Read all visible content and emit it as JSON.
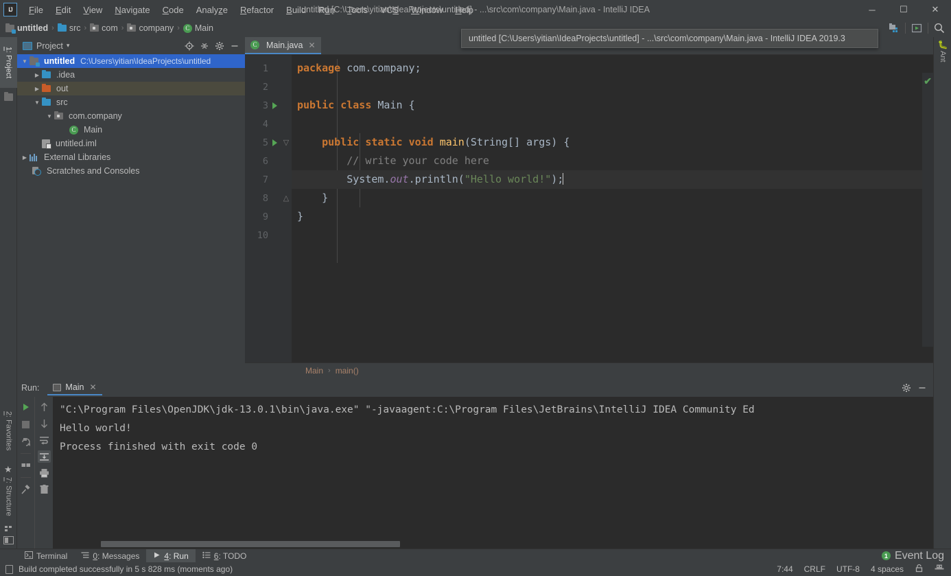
{
  "window": {
    "title": "untitled [C:\\Users\\yitian\\IdeaProjects\\untitled] - ...\\src\\com\\company\\Main.java - IntelliJ IDEA",
    "logo_text": "IJ",
    "minimize": "─",
    "maximize": "☐",
    "close": "✕"
  },
  "tooltip": {
    "text": "untitled [C:\\Users\\yitian\\IdeaProjects\\untitled] - ...\\src\\com\\company\\Main.java - IntelliJ IDEA 2019.3"
  },
  "menu": [
    {
      "label": "File",
      "mnemonic": "F"
    },
    {
      "label": "Edit",
      "mnemonic": "E"
    },
    {
      "label": "View",
      "mnemonic": "V"
    },
    {
      "label": "Navigate",
      "mnemonic": "N"
    },
    {
      "label": "Code",
      "mnemonic": "C"
    },
    {
      "label": "Analyze",
      "mnemonic": "z"
    },
    {
      "label": "Refactor",
      "mnemonic": "R"
    },
    {
      "label": "Build",
      "mnemonic": "B"
    },
    {
      "label": "Run",
      "mnemonic": "u"
    },
    {
      "label": "Tools",
      "mnemonic": "T"
    },
    {
      "label": "VCS",
      "mnemonic": "S"
    },
    {
      "label": "Window",
      "mnemonic": "W"
    },
    {
      "label": "Help",
      "mnemonic": "H"
    }
  ],
  "navbar": {
    "crumbs": [
      {
        "label": "untitled",
        "icon": "project-icon"
      },
      {
        "label": "src",
        "icon": "folder-blue-icon"
      },
      {
        "label": "com",
        "icon": "folder-package-icon"
      },
      {
        "label": "company",
        "icon": "folder-package-icon"
      },
      {
        "label": "Main",
        "icon": "java-class-icon"
      }
    ],
    "separator": "›"
  },
  "toolbar_right": {
    "icons": [
      "project-structure-icon",
      "run-console-icon",
      "search-everywhere-icon"
    ]
  },
  "left_rail": {
    "project": {
      "prefix": "1",
      "label": ": Project"
    },
    "favorites": {
      "prefix": "2",
      "label": ": Favorites"
    },
    "structure": {
      "prefix": "7",
      "label": ": Structure"
    }
  },
  "right_rail": {
    "ant": "Ant"
  },
  "project_panel": {
    "title": "Project",
    "chevron": "▾",
    "header_icons": [
      "locate-target-icon",
      "collapse-all-icon",
      "settings-gear-icon",
      "minimize-icon"
    ],
    "tree": [
      {
        "label": "untitled",
        "path": "C:\\Users\\yitian\\IdeaProjects\\untitled",
        "indent": 0,
        "arrow": "▼",
        "icon": "project-icon",
        "state": "selected",
        "bold": true
      },
      {
        "label": ".idea",
        "path": "",
        "indent": 1,
        "arrow": "▶",
        "icon": "folder-blue-icon",
        "state": "normal",
        "bold": false
      },
      {
        "label": "out",
        "path": "",
        "indent": 1,
        "arrow": "▶",
        "icon": "folder-orange-icon",
        "state": "hovered",
        "bold": false
      },
      {
        "label": "src",
        "path": "",
        "indent": 1,
        "arrow": "▼",
        "icon": "folder-blue-icon",
        "state": "normal",
        "bold": false
      },
      {
        "label": "com.company",
        "path": "",
        "indent": 2,
        "arrow": "▼",
        "icon": "folder-package-icon",
        "state": "normal",
        "bold": false
      },
      {
        "label": "Main",
        "path": "",
        "indent": 3,
        "arrow": "",
        "icon": "java-class-icon",
        "state": "normal",
        "bold": false
      },
      {
        "label": "untitled.iml",
        "path": "",
        "indent": 1,
        "arrow": "",
        "icon": "iml-file-icon",
        "state": "normal",
        "bold": false
      },
      {
        "label": "External Libraries",
        "path": "",
        "indent": 0,
        "arrow": "▶",
        "icon": "library-icon",
        "state": "normal",
        "bold": false
      },
      {
        "label": "Scratches and Consoles",
        "path": "",
        "indent": 0,
        "arrow": "",
        "icon": "scratches-icon",
        "state": "normal",
        "bold": false
      }
    ]
  },
  "editor": {
    "tab": {
      "label": "Main.java",
      "close": "✕",
      "icon": "java-class-icon"
    },
    "line_numbers": [
      "1",
      "2",
      "3",
      "4",
      "5",
      "6",
      "7",
      "8",
      "9",
      "10"
    ],
    "current_line": 7,
    "run_markers": [
      3,
      5
    ],
    "fold_markers": [
      5,
      8
    ],
    "inspection_status": "no-errors",
    "inspection_glyph": "✔",
    "code": {
      "l1_kw": "package",
      "l1_pkg": " com.company;",
      "l3_public": "public",
      "l3_class": "class",
      "l3_name": " Main ",
      "l3_brace": "{",
      "l5_public": "public",
      "l5_static": "static",
      "l5_void": "void",
      "l5_main": "main",
      "l5_args": "(String[] args) {",
      "l6_comment": "// write your code here",
      "l7_system": "System.",
      "l7_out": "out",
      "l7_println": ".println(",
      "l7_string": "\"Hello world!\"",
      "l7_tail": ");",
      "l8_brace": "}",
      "l9_brace": "}"
    },
    "breadcrumb": {
      "class": "Main",
      "method": "main()",
      "separator": "›"
    }
  },
  "run_panel": {
    "label": "Run:",
    "tab": {
      "label": "Main",
      "close": "✕"
    },
    "header_icons": [
      "settings-gear-icon",
      "minimize-icon"
    ],
    "tools_left": [
      "rerun-icon",
      "stop-icon",
      "rerun-failed-icon",
      "layout-icon",
      "pin-tab-icon"
    ],
    "tools_right": [
      "scroll-up-icon",
      "scroll-down-icon",
      "soft-wrap-icon",
      "scroll-to-end-icon",
      "print-icon",
      "clear-all-icon"
    ],
    "console_lines": [
      "\"C:\\Program Files\\OpenJDK\\jdk-13.0.1\\bin\\java.exe\" \"-javaagent:C:\\Program Files\\JetBrains\\IntelliJ IDEA Community Ed",
      "Hello world!",
      "",
      "Process finished with exit code 0"
    ]
  },
  "bottom_tabs": [
    {
      "prefix": "",
      "label": "Terminal",
      "icon": "terminal-icon",
      "active": false
    },
    {
      "prefix": "0",
      "label": ": Messages",
      "icon": "messages-icon",
      "active": false
    },
    {
      "prefix": "4",
      "label": ": Run",
      "icon": "run-icon",
      "active": true
    },
    {
      "prefix": "6",
      "label": ": TODO",
      "icon": "todo-icon",
      "active": false
    }
  ],
  "event_log": {
    "count": "1",
    "label": "Event Log"
  },
  "statusbar": {
    "message": "Build completed successfully in 5 s 828 ms (moments ago)",
    "caret_position": "7:44",
    "line_separator": "CRLF",
    "encoding": "UTF-8",
    "indent": "4 spaces",
    "lock_icon": "⚿",
    "inspector_icon": "⚑"
  }
}
